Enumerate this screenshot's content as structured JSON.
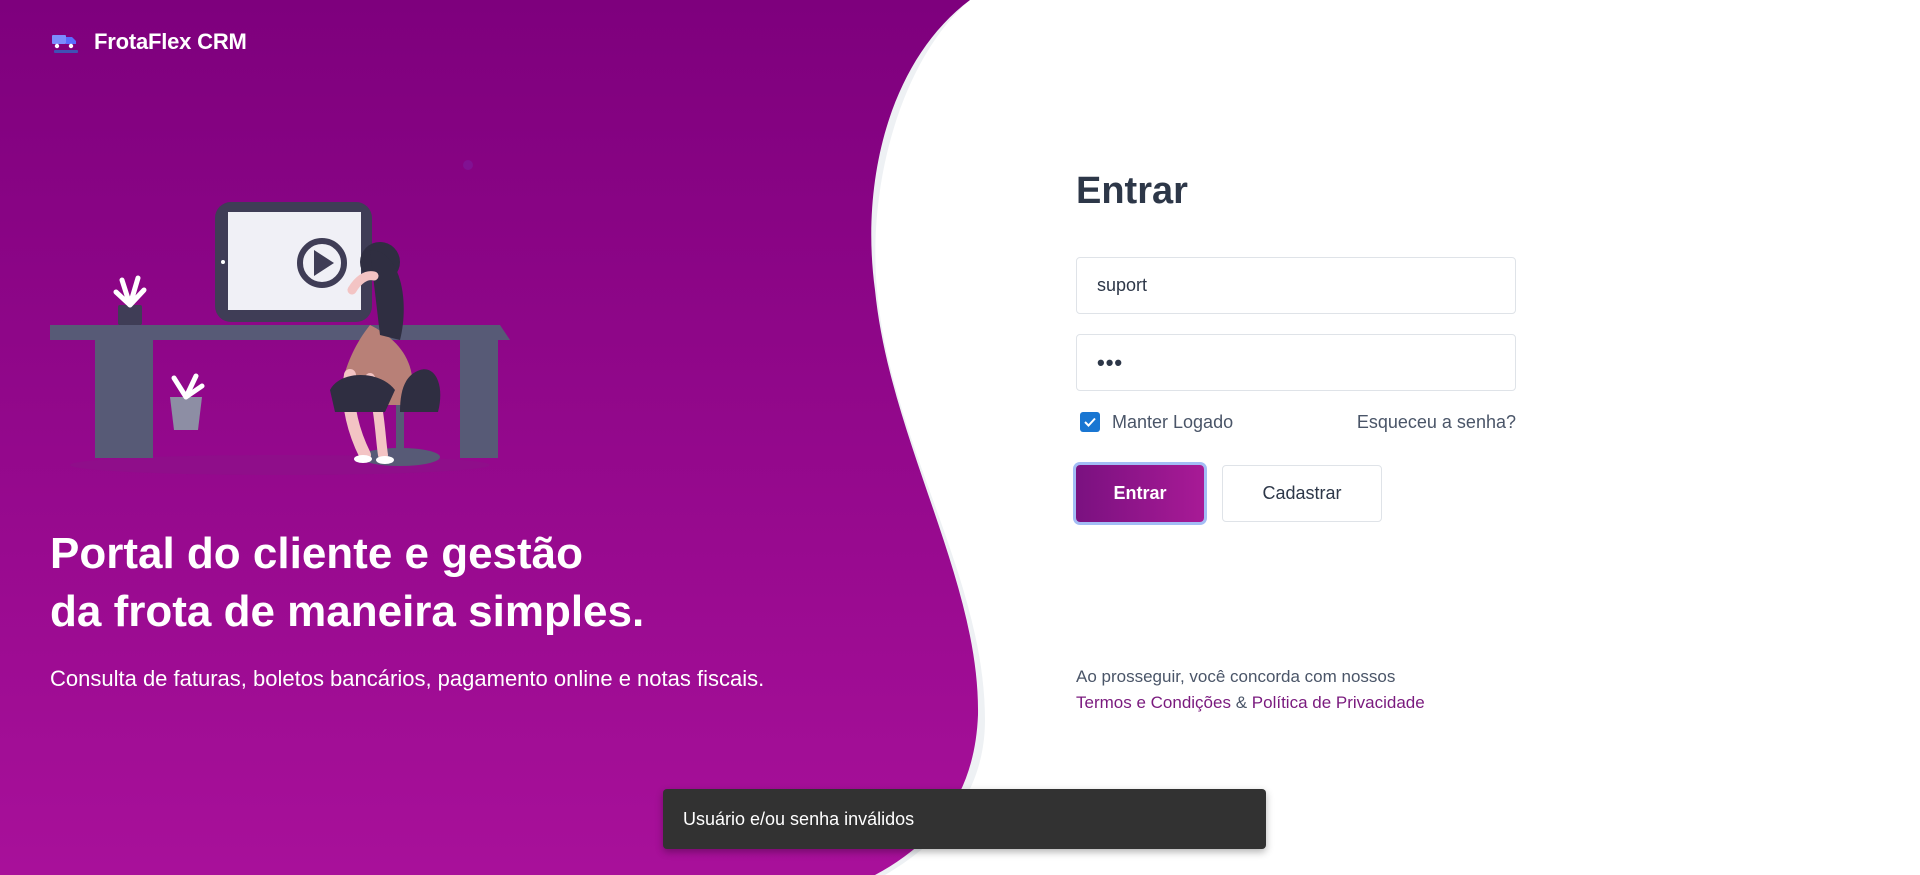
{
  "brand": {
    "name": "FrotaFlex CRM",
    "logo_icon": "truck-logo-icon"
  },
  "hero": {
    "headline_line1": "Portal do cliente e gestão",
    "headline_line2": "da frota de maneira simples.",
    "subtext": "Consulta de faturas, boletos bancários, pagamento online e notas fiscais.",
    "illustration": "woman-at-desk-watching-video-illustration"
  },
  "login": {
    "title": "Entrar",
    "username_value": "suport",
    "password_value": "•••",
    "remember_label": "Manter Logado",
    "remember_checked": true,
    "forgot_label": "Esqueceu a senha?",
    "submit_label": "Entrar",
    "register_label": "Cadastrar"
  },
  "terms": {
    "prefix": "Ao prosseguir, você concorda com nossos",
    "terms_link": "Termos e Condições",
    "separator": "&",
    "privacy_link": "Política de Privacidade"
  },
  "toast": {
    "message": "Usuário e/ou senha inválidos"
  },
  "colors": {
    "brand_purple": "#800080",
    "brand_magenta": "#a8109a",
    "checkbox_blue": "#1976d2",
    "text_dark": "#2d3748",
    "toast_bg": "#323232"
  }
}
